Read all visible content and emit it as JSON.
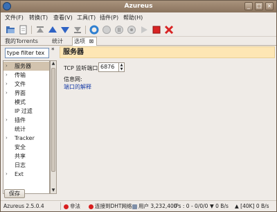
{
  "window": {
    "title": "Azureus"
  },
  "window_buttons": {
    "minimize": "_",
    "maximize": "□",
    "close": "×"
  },
  "menubar": {
    "items": [
      {
        "label": "文件(F)"
      },
      {
        "label": "转换(T)"
      },
      {
        "label": "查看(V)"
      },
      {
        "label": "工具(T)"
      },
      {
        "label": "插件(P)"
      },
      {
        "label": "帮助(H)"
      }
    ]
  },
  "toolbar": {
    "icons": [
      "open-torrent-icon",
      "new-torrent-icon",
      "start-icon",
      "up-icon",
      "down-icon",
      "remove-icon",
      "refresh-icon",
      "stop-icon",
      "pause-icon",
      "play-icon",
      "stop-red-icon",
      "delete-icon"
    ]
  },
  "tabs": {
    "items": [
      {
        "label": "我的Torrents"
      },
      {
        "label": "统计"
      },
      {
        "label": "选项"
      }
    ],
    "close_glyph": "⊠"
  },
  "sidebar": {
    "filter_value": "type filter tex",
    "filter_star": "*",
    "tree_items": [
      {
        "label": "服务器",
        "expander": "›",
        "selected": true
      },
      {
        "label": "传输",
        "expander": "›"
      },
      {
        "label": "文件",
        "expander": "›"
      },
      {
        "label": "界面",
        "expander": "›"
      },
      {
        "label": "模式",
        "expander": ""
      },
      {
        "label": "IP 过滤",
        "expander": ""
      },
      {
        "label": "插件",
        "expander": "›"
      },
      {
        "label": "统计",
        "expander": ""
      },
      {
        "label": "Tracker",
        "expander": "›"
      },
      {
        "label": "安全",
        "expander": ""
      },
      {
        "label": "共享",
        "expander": ""
      },
      {
        "label": "日志",
        "expander": ""
      },
      {
        "label": "Ext",
        "expander": "›"
      }
    ],
    "scroll_up": "▲",
    "scroll_down": "▼",
    "save_label": "保存"
  },
  "main": {
    "header": "服务器",
    "port_label": "TCP 监听端口",
    "port_value": "6876",
    "spinner_up": "▲",
    "spinner_down": "▼",
    "info_label": "信息网:",
    "info_link": "端口的解释"
  },
  "statusbar": {
    "version": "Azureus 2.5.0.4",
    "nat": "非法",
    "dht": "连接到DHT网络",
    "users": "用户 3,232,400",
    "ips": "IPs : 0 - 0/0/0",
    "down": "▼ 0 B/s",
    "up": "▲ [40K] 0 B/s"
  },
  "colors": {
    "title_bar": "#9b8470",
    "header_bg": "#fde6b4",
    "status_red": "#d81e1e",
    "status_green": "#2eaa2e",
    "link": "#1b3fa8"
  }
}
